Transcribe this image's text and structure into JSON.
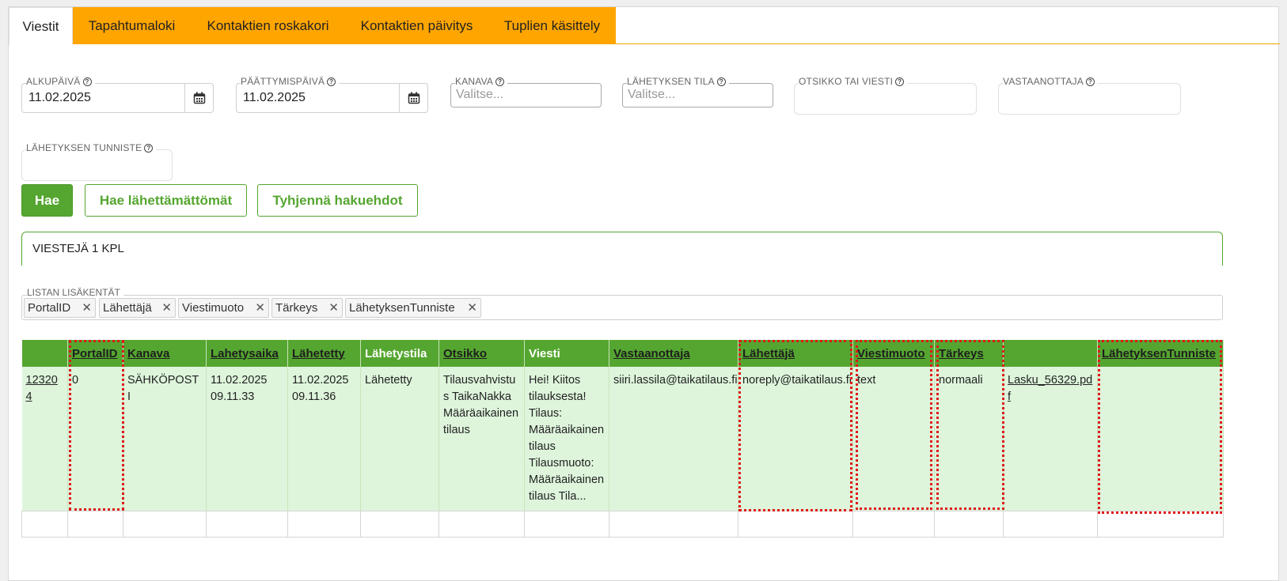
{
  "tabs": [
    {
      "label": "Viestit",
      "active": true
    },
    {
      "label": "Tapahtumaloki",
      "active": false
    },
    {
      "label": "Kontaktien roskakori",
      "active": false
    },
    {
      "label": "Kontaktien päivitys",
      "active": false
    },
    {
      "label": "Tuplien käsittely",
      "active": false
    }
  ],
  "filters": {
    "alkupaiva": {
      "label": "ALKUPÄIVÄ",
      "value": "11.02.2025"
    },
    "paattymispaiva": {
      "label": "PÄÄTTYMISPÄIVÄ",
      "value": "11.02.2025"
    },
    "kanava": {
      "label": "KANAVA",
      "placeholder": "Valitse..."
    },
    "lahetyksen_tila": {
      "label": "LÄHETYKSEN TILA",
      "placeholder": "Valitse..."
    },
    "otsikko": {
      "label": "OTSIKKO TAI VIESTI",
      "value": ""
    },
    "vastaanottaja": {
      "label": "VASTAANOTTAJA",
      "value": ""
    },
    "tunniste": {
      "label": "LÄHETYKSEN TUNNISTE",
      "value": ""
    }
  },
  "buttons": {
    "hae": "Hae",
    "hae_lahettamattomat": "Hae lähettämättömät",
    "tyhjenna": "Tyhjennä hakuehdot"
  },
  "result_count": "VIESTEJÄ 1 KPL",
  "extra_fields": {
    "label": "LISTAN LISÄKENTÄT",
    "chips": [
      "PortalID",
      "Lähettäjä",
      "Viestimuoto",
      "Tärkeys",
      "LähetyksenTunniste"
    ]
  },
  "table": {
    "headers": [
      "",
      "PortalID",
      "Kanava",
      "Lahetysaika",
      "Lähetetty",
      "Lähetystila",
      "Otsikko",
      "Viesti",
      "Vastaanottaja",
      "Lähettäjä",
      "Viestimuoto",
      "Tärkeys",
      "",
      "LähetyksenTunniste"
    ],
    "row": {
      "id": "123204",
      "portal_id": "0",
      "kanava": "SÄHKÖPOSTI",
      "lahetysaika": "11.02.2025 09.11.33",
      "lahetetty": "11.02.2025 09.11.36",
      "lahetystila": "Lähetetty",
      "otsikko": "Tilausvahvistus TaikaNakka Määräaikainen tilaus",
      "viesti": "Hei! Kiitos tilauksesta! Tilaus: Määräaikainen tilaus Tilausmuoto: Määräaikainen tilaus Tila...",
      "vastaanottaja": "siiri.lassila@taikatilaus.fi",
      "lahettaja": "noreply@taikatilaus.fi",
      "viestimuoto": "text",
      "tarkeys": "normaali",
      "liite": "Lasku_56329.pdf",
      "tunniste": ""
    }
  },
  "colors": {
    "accent": "#55a630",
    "tab": "#ffa500",
    "row": "#def5dc",
    "highlight": "#e01919"
  }
}
